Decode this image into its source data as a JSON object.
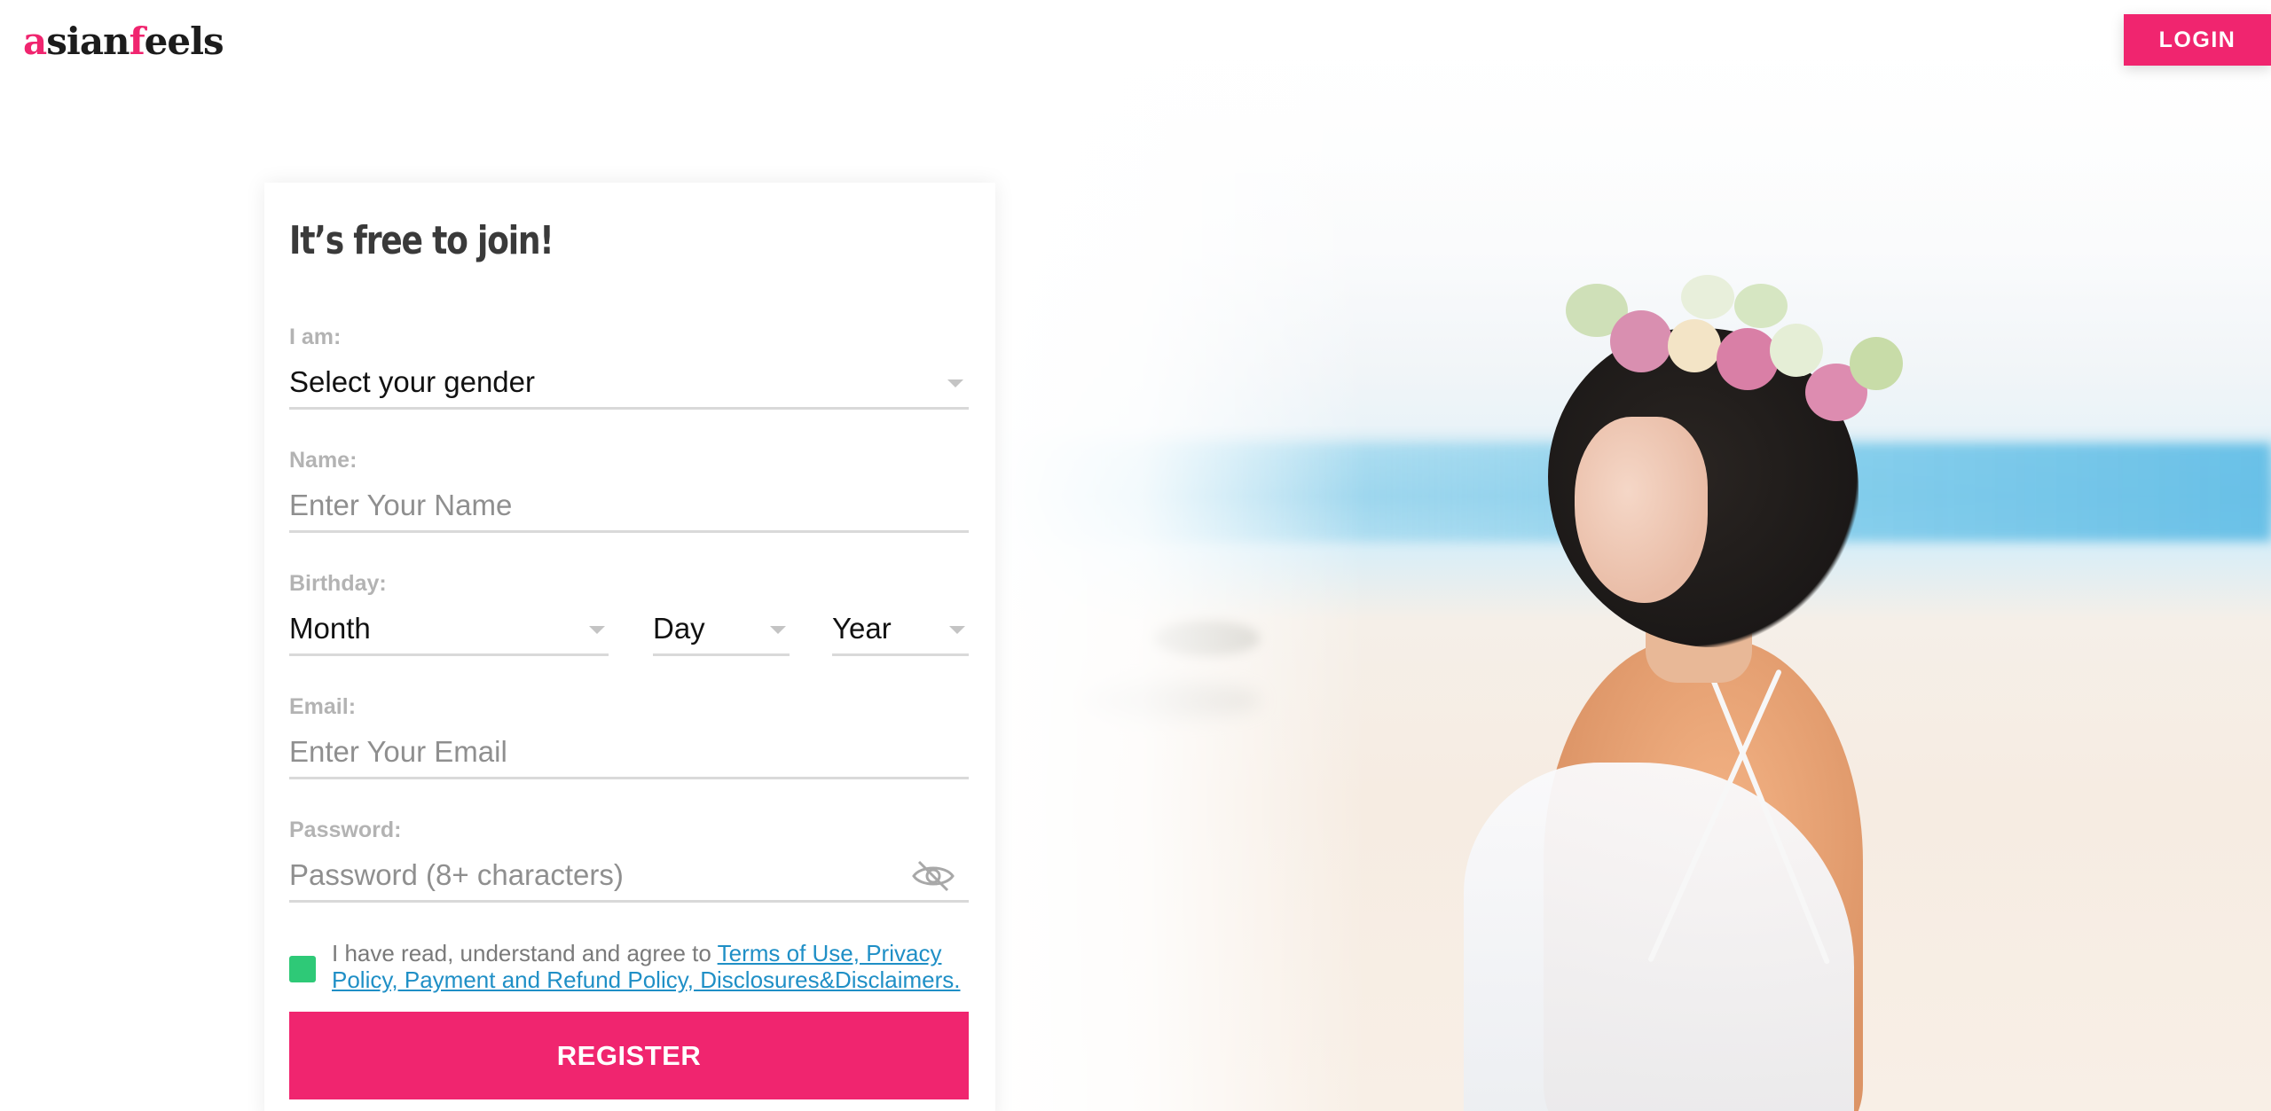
{
  "header": {
    "logo_part1": "a",
    "logo_part2": "sian",
    "logo_part3": "f",
    "logo_part4": "eels",
    "login_label": "LOGIN"
  },
  "form": {
    "title": "It’s free to join!",
    "gender": {
      "label": "I am:",
      "value": "Select your gender"
    },
    "name": {
      "label": "Name:",
      "placeholder": "Enter Your Name"
    },
    "birthday": {
      "label": "Birthday:",
      "month": "Month",
      "day": "Day",
      "year": "Year"
    },
    "email": {
      "label": "Email:",
      "placeholder": "Enter Your Email"
    },
    "password": {
      "label": "Password:",
      "placeholder": "Password (8+ characters)"
    },
    "terms": {
      "prefix": "I have read, understand and agree to ",
      "link_text": "Terms of Use, Privacy Policy, Payment and Refund Policy, Disclosures&Disclaimers.",
      "checked": true
    },
    "register_label": "REGISTER"
  },
  "colors": {
    "brand_pink": "#f0256f",
    "checkbox_green": "#2ec977",
    "link_blue": "#1f8fc6"
  },
  "icons": {
    "password_toggle": "eye-slash-icon",
    "dropdown": "caret-down-icon"
  }
}
